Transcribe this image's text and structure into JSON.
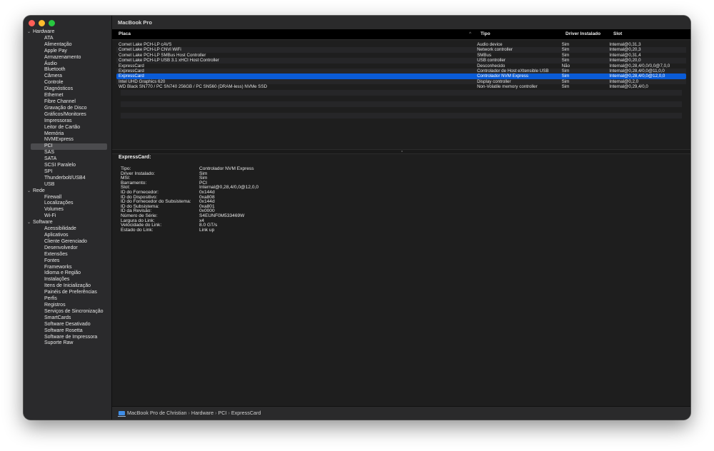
{
  "window": {
    "title": "MacBook Pro"
  },
  "sidebar": {
    "groups": [
      {
        "label": "Hardware",
        "items": [
          "ATA",
          "Alimentação",
          "Apple Pay",
          "Armazenamento",
          "Áudio",
          "Bluetooth",
          "Câmera",
          "Controle",
          "Diagnósticos",
          "Ethernet",
          "Fibre Channel",
          "Gravação de Disco",
          "Gráficos/Monitores",
          "Impressoras",
          "Leitor de Cartão",
          "Memória",
          "NVMExpress",
          "PCI",
          "SAS",
          "SATA",
          "SCSI Paralelo",
          "SPI",
          "Thunderbolt/USB4",
          "USB"
        ]
      },
      {
        "label": "Rede",
        "items": [
          "Firewall",
          "Localizações",
          "Volumes",
          "Wi-Fi"
        ]
      },
      {
        "label": "Software",
        "items": [
          "Acessibilidade",
          "Aplicativos",
          "Cliente Gerenciado",
          "Desenvolvedor",
          "Extensões",
          "Fontes",
          "Frameworks",
          "Idioma e Região",
          "Instalações",
          "Itens de Inicialização",
          "Painéis de Preferências",
          "Perfis",
          "Registros",
          "Serviços de Sincronização",
          "SmartCards",
          "Software Desativado",
          "Software Rosetta",
          "Software de Impressora",
          "Suporte Raw"
        ]
      }
    ],
    "selected": "PCI"
  },
  "table": {
    "columns": [
      "Placa",
      "Tipo",
      "Driver Instalado",
      "Slot"
    ],
    "sort_indicator": "^",
    "rows": [
      [
        "Comet Lake PCH-LP cAVS",
        "Audio device",
        "Sim",
        "Internal@0,31,3"
      ],
      [
        "Comet Lake PCH-LP CNVi WiFi",
        "Network controller",
        "Sim",
        "Internal@0,20,3"
      ],
      [
        "Comet Lake PCH-LP SMBus Host Controller",
        "SMBus",
        "Sim",
        "Internal@0,31,4"
      ],
      [
        "Comet Lake PCH-LP USB 3.1 xHCI Host Controller",
        "USB controller",
        "Sim",
        "Internal@0,20,0"
      ],
      [
        "ExpressCard",
        "Desconhecido",
        "Não",
        "Internal@0,28,4/0,0/0,0@7,0,0"
      ],
      [
        "ExpressCard",
        "Controlador de Host eXtensible USB",
        "Sim",
        "Internal@0,28,4/0,0@11,0,0"
      ],
      [
        "ExpressCard",
        "Controlador NVM Express",
        "Sim",
        "Internal@0,28,4/0,0@12,0,0"
      ],
      [
        "Intel UHD Graphics 620",
        "Display controller",
        "Sim",
        "Internal@0,2,0"
      ],
      [
        "WD Black SN770 / PC SN740 256GB / PC SN560 (DRAM-less) NVMe SSD",
        "Non-Volatile memory controller",
        "Sim",
        "Internal@0,29,4/0,0"
      ]
    ],
    "selected_index": 6
  },
  "detail": {
    "title": "ExpressCard:",
    "fields": [
      [
        "Tipo:",
        "Controlador NVM Express"
      ],
      [
        "Driver Instalado:",
        "Sim"
      ],
      [
        "MSI:",
        "Sim"
      ],
      [
        "Barramento:",
        "PCI"
      ],
      [
        "Slot:",
        "Internal@0,28,4/0,0@12,0,0"
      ],
      [
        "ID do Fornecedor:",
        "0x144d"
      ],
      [
        "ID do Dispositivo:",
        "0xa808"
      ],
      [
        "ID do Fornecedor do Subsistema:",
        "0x144d"
      ],
      [
        "ID do Subsistema:",
        "0xa801"
      ],
      [
        "ID da Revisão:",
        "0x0000"
      ],
      [
        "Número de Série:",
        "S4EUNF0M533469W"
      ],
      [
        "Largura do Link:",
        "x4"
      ],
      [
        "Velocidade do Link:",
        "8.0 GT/s"
      ],
      [
        "Estado do Link:",
        "Link up"
      ]
    ]
  },
  "statusbar": {
    "icon": "macbook-icon",
    "path": [
      "MacBook Pro de Christian",
      "Hardware",
      "PCI",
      "ExpressCard"
    ],
    "separator": "›"
  }
}
